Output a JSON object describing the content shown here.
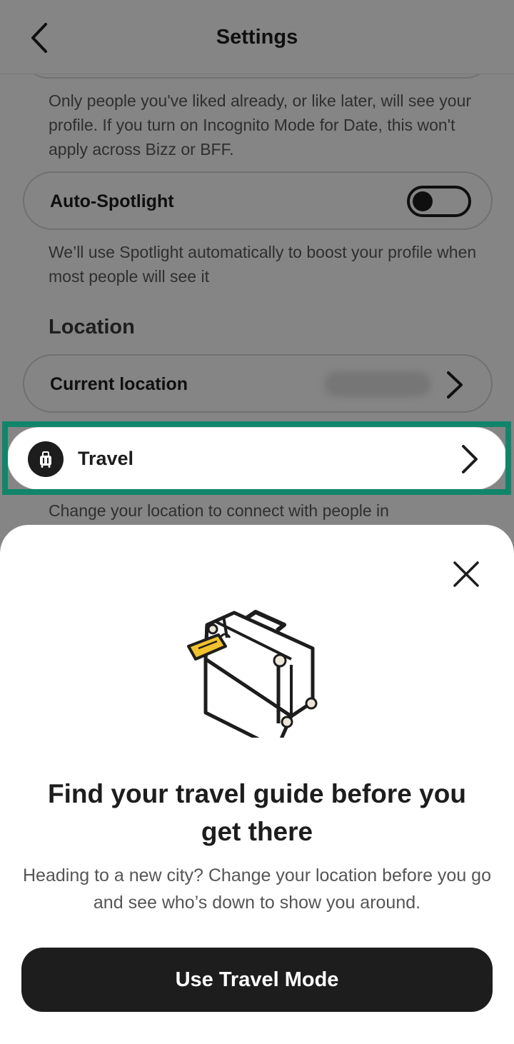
{
  "header": {
    "title": "Settings"
  },
  "incognito_note": "Only people you've liked already, or like later, will see your profile. If you turn on Incognito Mode for Date, this won't apply across Bizz or BFF.",
  "auto_spotlight": {
    "label": "Auto-Spotlight",
    "enabled": false,
    "note": "We’ll use Spotlight automatically to boost your profile when most people will see it"
  },
  "location": {
    "section_title": "Location",
    "current_location_label": "Current location",
    "travel_label": "Travel",
    "travel_note": "Change your location to connect with people in"
  },
  "sheet": {
    "title": "Find your travel guide before you get there",
    "body": "Heading to a new city? Change your location before you go and see who’s down to show you around.",
    "cta_label": "Use Travel Mode"
  },
  "icons": {
    "back": "chevron-left-icon",
    "chevron": "chevron-right-icon",
    "travel": "suitcase-icon",
    "close": "close-icon",
    "illustration": "suitcase-illustration"
  },
  "colors": {
    "highlight": "#11856a",
    "tag": "#f2c12e",
    "dark": "#1d1d1d"
  }
}
